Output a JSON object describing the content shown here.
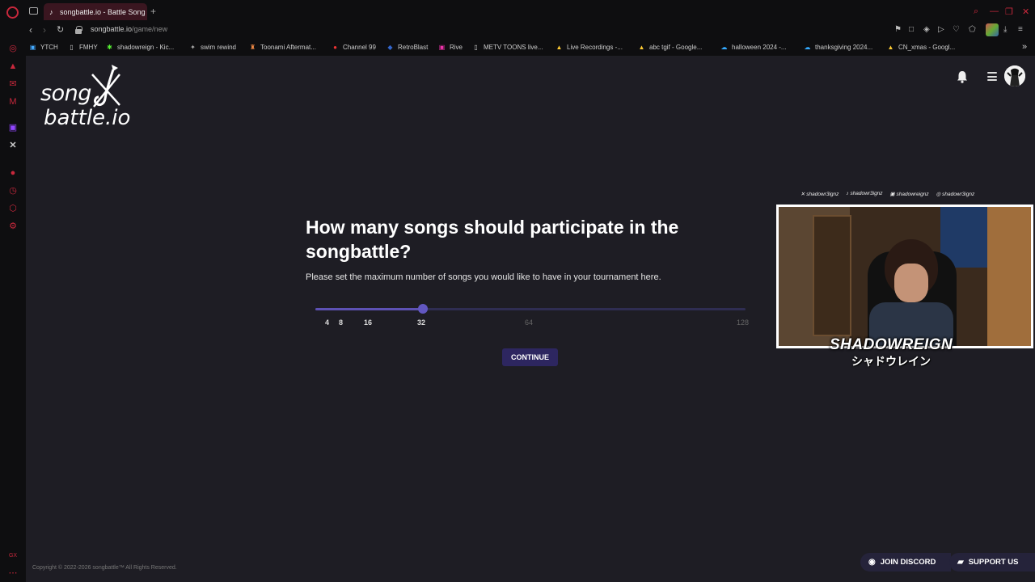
{
  "browser": {
    "tab_title": "songbattle.io - Battle Song",
    "url_host": "songbattle.io",
    "url_path": "/game/new",
    "bookmarks": [
      {
        "label": "YTCH"
      },
      {
        "label": "FMHY"
      },
      {
        "label": "shadowreign - Kic..."
      },
      {
        "label": "swim rewind"
      },
      {
        "label": "Toonami Aftermat..."
      },
      {
        "label": "Channel 99"
      },
      {
        "label": "RetroBlast"
      },
      {
        "label": "Rive"
      },
      {
        "label": "METV TOONS live..."
      },
      {
        "label": "Live Recordings -..."
      },
      {
        "label": "abc tgif - Google..."
      },
      {
        "label": "halloween 2024 -..."
      },
      {
        "label": "thanksgiving 2024..."
      },
      {
        "label": "CN_xmas - Googl..."
      }
    ]
  },
  "logo": {
    "line1": "song",
    "line2": "battle.io"
  },
  "main": {
    "question": "How many songs should participate in the songbattle?",
    "subtext": "Please set the maximum number of songs you would like to have in your tournament here.",
    "slider": {
      "ticks": [
        "4",
        "8",
        "16",
        "32",
        "64",
        "128"
      ],
      "selected": 32,
      "selected_fraction": 0.25
    },
    "continue_label": "CONTINUE"
  },
  "footer": {
    "copyright": "Copyright © 2022-2026 songbattle™ All Rights Reserved.",
    "discord_label": "JOIN DISCORD",
    "support_label": "SUPPORT US"
  },
  "overlay": {
    "socials": [
      "shadowr3ignz",
      "shadowr3ignz",
      "shadowreignz",
      "shadowr3ignz"
    ],
    "name": "SHADOWREIGN",
    "name_jp": "シャドウレイン"
  },
  "colors": {
    "accent": "#5d51b4",
    "button": "#2d2660",
    "page_bg": "#1e1d24",
    "browser_accent": "#c8283c"
  }
}
